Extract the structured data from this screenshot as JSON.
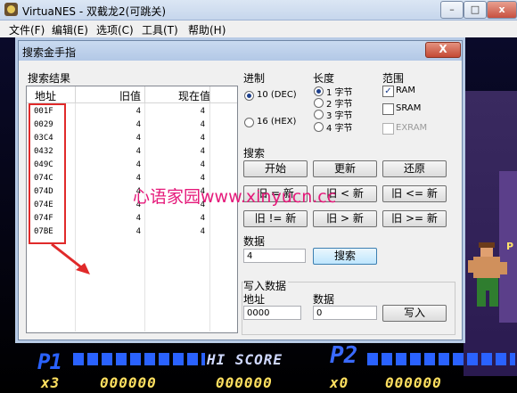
{
  "app": {
    "title": "VirtuaNES - 双截龙2(可跳关)",
    "menus": [
      "文件(F)",
      "编辑(E)",
      "选项(C)",
      "工具(T)",
      "帮助(H)"
    ]
  },
  "dialog": {
    "title": "搜索金手指",
    "close_label": "X",
    "results": {
      "group_label": "搜索结果",
      "headers": {
        "addr": "地址",
        "old": "旧值",
        "new": "现在值"
      },
      "rows": [
        {
          "addr": "001F",
          "old": "4",
          "new": "4"
        },
        {
          "addr": "0029",
          "old": "4",
          "new": "4"
        },
        {
          "addr": "03C4",
          "old": "4",
          "new": "4"
        },
        {
          "addr": "0432",
          "old": "4",
          "new": "4"
        },
        {
          "addr": "049C",
          "old": "4",
          "new": "4"
        },
        {
          "addr": "074C",
          "old": "4",
          "new": "4"
        },
        {
          "addr": "074D",
          "old": "4",
          "new": "4"
        },
        {
          "addr": "074E",
          "old": "4",
          "new": "4"
        },
        {
          "addr": "074F",
          "old": "4",
          "new": "4"
        },
        {
          "addr": "07BE",
          "old": "4",
          "new": "4"
        }
      ]
    },
    "radix": {
      "label": "进制",
      "options": [
        {
          "label": "10 (DEC)",
          "selected": true
        },
        {
          "label": "16 (HEX)",
          "selected": false
        }
      ]
    },
    "length": {
      "label": "长度",
      "options": [
        {
          "label": "1 字节",
          "selected": true
        },
        {
          "label": "2 字节",
          "selected": false
        },
        {
          "label": "3 字节",
          "selected": false
        },
        {
          "label": "4 字节",
          "selected": false
        }
      ]
    },
    "range": {
      "label": "范围",
      "options": [
        {
          "label": "RAM",
          "checked": true,
          "enabled": true
        },
        {
          "label": "SRAM",
          "checked": false,
          "enabled": true
        },
        {
          "label": "EXRAM",
          "checked": false,
          "enabled": false
        }
      ]
    },
    "search": {
      "label": "搜索",
      "buttons": {
        "start": "开始",
        "update": "更新",
        "restore": "还原",
        "eq": "旧 = 新",
        "lt": "旧 < 新",
        "le": "旧 <= 新",
        "ne": "旧 != 新",
        "gt": "旧 > 新",
        "ge": "旧 >= 新",
        "search": "搜索"
      }
    },
    "data": {
      "label": "数据",
      "value": "4"
    },
    "write": {
      "label": "写入数据",
      "addr_label": "地址",
      "addr_value": "0000",
      "data_label": "数据",
      "data_value": "0",
      "button": "写入"
    }
  },
  "watermark": "心语家园www.xinyucn.cc",
  "game_hud": {
    "p1": "P1",
    "hi_score": "HI SCORE",
    "p2": "P2",
    "p1_lives": "x3",
    "p1_score": "000000",
    "hi_value": "000000",
    "p2_lives": "x0",
    "p2_score": "000000"
  }
}
